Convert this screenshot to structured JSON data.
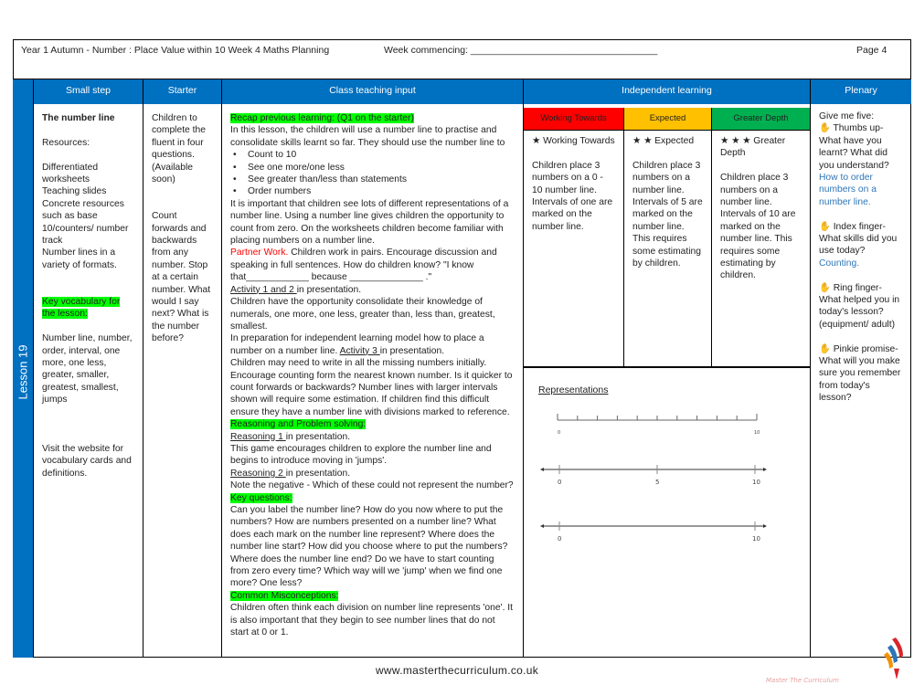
{
  "header": {
    "title": "Year 1 Autumn -  Number : Place Value within 10 Week 4 Maths Planning",
    "week": "Week commencing: ___________________________________",
    "page": "Page 4"
  },
  "lesson": "Lesson 19",
  "columns": [
    "Small step",
    "Starter",
    "Class teaching input",
    "Independent learning",
    "Plenary"
  ],
  "small_step": {
    "title": "The number line",
    "resources_label": "Resources:",
    "resources": [
      "Differentiated worksheets",
      "Teaching slides",
      "Concrete resources such as base 10/counters/ number track",
      "Number lines in a variety of formats."
    ],
    "vocab_label": "Key vocabulary for the lesson:",
    "vocab": "Number line, number, order, interval, one more, one less, greater, smaller, greatest, smallest, jumps",
    "website": "Visit the website for vocabulary cards and definitions."
  },
  "starter": {
    "p1": "Children to complete the fluent in four questions. (Available soon)",
    "p2": "Count forwards and backwards from any number. Stop at a certain number. What would I say next? What is the number before?"
  },
  "teaching": {
    "recap": "Recap previous learning: (Q1 on the starter)",
    "intro": "In this lesson, the children will use a number line to practise and consolidate skills learnt so far. They should use the number line to",
    "bullets": [
      "Count to 10",
      "See one more/one less",
      "See greater than/less than statements",
      "Order numbers"
    ],
    "p2": "It is important that children see lots of different representations of a number line. Using a number line gives children the opportunity to count from zero. On the worksheets children become familiar with placing numbers on a number line.",
    "partner": "Partner Work.",
    "partner_text": " Children work  in pairs. Encourage discussion and speaking in full sentences. How do children know?  \"I know that____________ because ______________ .\"",
    "act12": "Activity 1 and 2 ",
    "act12_text": "in presentation.",
    "p3": "Children have the opportunity consolidate their knowledge of numerals, one more, one less, greater than, less than, greatest, smallest.",
    "p4": "In preparation for independent learning  model how to place a number on a number line. ",
    "act3": "Activity 3 ",
    "act3_text": "in presentation.",
    "p5": "Children may need to write in all the missing numbers initially. Encourage counting form the nearest known number. Is it quicker to count forwards or backwards? Number lines with larger intervals shown will require some estimation. If children find this difficult ensure they have a number line with divisions marked to reference.",
    "rps": "Reasoning and Problem solving:",
    "r1": "Reasoning 1 ",
    "r1_text": "in presentation.",
    "r1_desc": "This game encourages children to explore the number line and begins to introduce moving in 'jumps'.",
    "r2": "Reasoning 2 ",
    "r2_text": "in presentation.",
    "r2_desc": "Note the negative - Which of these could not represent the number?",
    "kq": "Key questions:",
    "kq_text": "Can you label the number line? How do you now where to put the numbers? How are numbers presented on a number line? What does each mark on the number line represent? Where  does the number line start?  How did you choose where to put the numbers? Where does the number line end? Do we have to start counting from zero every time? Which way will we 'jump' when we find one more? One less?",
    "cm": " Common Misconceptions:",
    "cm_text": "Children often think each division on  number line represents 'one'. It is  also important that they begin to see number lines that do not start at 0 or 1."
  },
  "independent": {
    "levels": [
      {
        "label": "Working Towards",
        "color": "#ff0000",
        "stars": 1,
        "title": "Working Towards",
        "text": "Children place 3 numbers on a 0 - 10 number line. Intervals of one are marked on the number line."
      },
      {
        "label": "Expected",
        "color": "#ffc000",
        "stars": 2,
        "title": "Expected",
        "text": "Children place 3 numbers on a number line. Intervals of 5 are marked on the number line. This requires some estimating by children."
      },
      {
        "label": "Greater Depth",
        "color": "#00b050",
        "stars": 3,
        "title": "Greater Depth",
        "text": "Children place 3 numbers on a number line. Intervals of 10 are marked on the number line. This requires some estimating by children."
      }
    ],
    "representations": "Representations",
    "lines": [
      {
        "start": "0",
        "mid": "",
        "end": "10"
      },
      {
        "start": "0",
        "mid": "5",
        "end": "10"
      },
      {
        "start": "0",
        "mid": "",
        "end": "10"
      }
    ]
  },
  "plenary": {
    "intro": "Give me five:",
    "items": [
      {
        "q": "Thumbs up- What have you learnt? What did you understand?",
        "a": "How to order numbers on a number line."
      },
      {
        "q": "Index finger- What skills did you use today?",
        "a": "Counting."
      },
      {
        "q": "Ring finger- What helped you in today's lesson? (equipment/ adult)",
        "a": ""
      },
      {
        "q": "Pinkie promise- What will you make sure you remember from today's lesson?",
        "a": ""
      }
    ]
  },
  "footer": {
    "url": "www.masterthecurriculum.co.uk",
    "logo": "Master The Curriculum"
  },
  "colors": {
    "header_blue": "#0070c0",
    "highlight": "#00ff00",
    "answer_blue": "#2e75b6"
  }
}
